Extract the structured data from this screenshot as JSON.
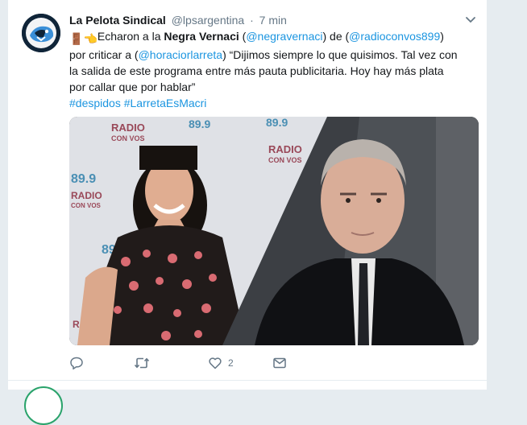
{
  "tweet": {
    "author": {
      "display_name": "La Pelota Sindical",
      "handle": "@lpsargentina",
      "separator": "·"
    },
    "time": "7 min",
    "text": {
      "emoji_1": "🚪",
      "emoji_2": "👈",
      "part_1": "Echaron a la ",
      "bold_name": "Negra Vernaci",
      "part_2": " (",
      "mention_1": "@negravernaci",
      "part_3": ") de (",
      "mention_2": "@radioconvos899",
      "part_4": ") por criticar a (",
      "mention_3": "@horaciorlarreta",
      "part_5": ")  “Dijimos siempre lo que quisimos. Tal vez con la salida de este programa entre más pauta publicitaria. Hoy hay más plata por callar que por hablar”",
      "hashtag_1": "#despidos",
      "hashtag_2": "#LarretaEsMacri"
    },
    "media": {
      "logo_text_1": "RADIO",
      "logo_text_2": "CON VOS",
      "logo_freq": "89.9"
    },
    "actions": {
      "reply_count": "",
      "retweet_count": "",
      "like_count": "2"
    }
  },
  "colors": {
    "link": "#1b95e0",
    "secondary_text": "#657786",
    "background": "#e6ecf0"
  }
}
